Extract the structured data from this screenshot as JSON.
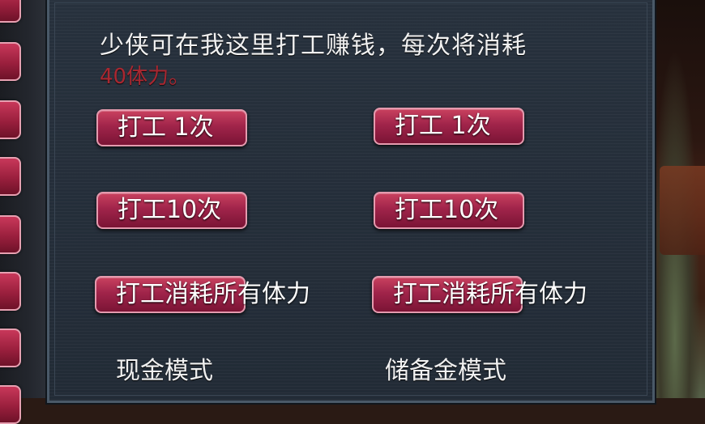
{
  "dialog": {
    "message_line1": "少侠可在我这里打工赚钱，每次将消耗",
    "message_line2": "40体力。"
  },
  "buttons": {
    "work_once_left": "打工 1次",
    "work_once_right": "打工 1次",
    "work_ten_left": "打工10次",
    "work_ten_right": "打工10次",
    "work_all_left": "打工消耗所有体力",
    "work_all_right": "打工消耗所有体力"
  },
  "modes": {
    "cash_mode": "现金模式",
    "reserve_mode": "储备金模式"
  },
  "colors": {
    "button_fill": "#a0244a",
    "button_border": "#e49aae",
    "panel_bg": "#242e39",
    "highlight_text": "#c0262f"
  }
}
